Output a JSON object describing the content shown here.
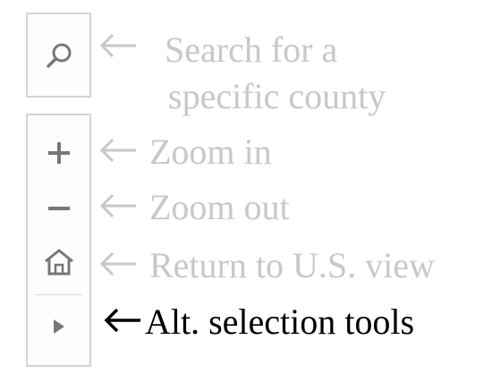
{
  "colors": {
    "muted_text": "#c8c8c8",
    "active_text": "#000000",
    "icon_gray": "#777777",
    "border": "#d4d4d4"
  },
  "map_controls": {
    "search": {
      "icon": "search-icon"
    },
    "zoom_in": {
      "icon": "plus-icon"
    },
    "zoom_out": {
      "icon": "minus-icon"
    },
    "home": {
      "icon": "home-icon"
    },
    "alt_tools": {
      "icon": "play-triangle-icon"
    }
  },
  "annotations": {
    "search_line1": "Search for a",
    "search_line2": "specific county",
    "zoom_in": "Zoom in",
    "zoom_out": "Zoom out",
    "home": "Return to U.S. view",
    "alt_tools": "Alt. selection tools"
  }
}
